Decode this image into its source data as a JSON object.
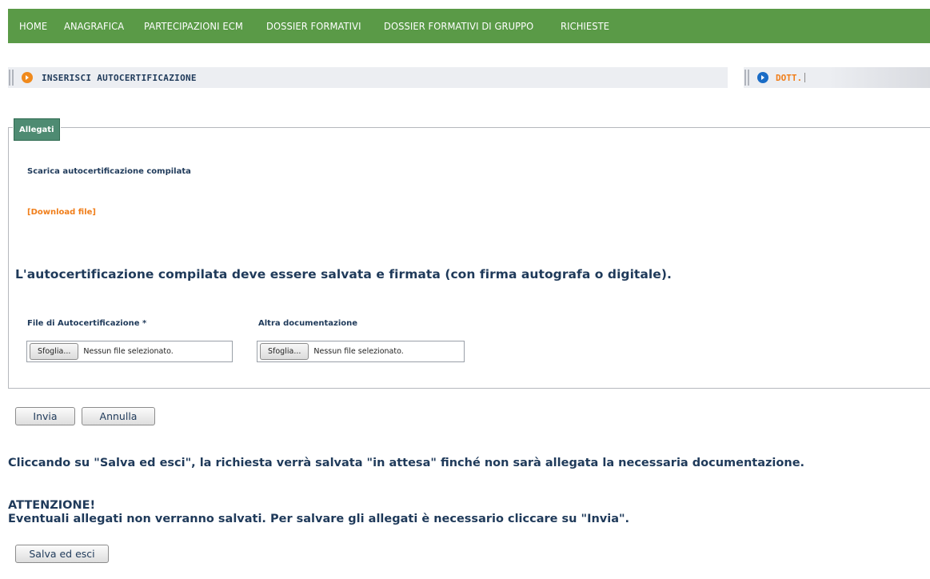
{
  "nav": {
    "items": [
      "HOME",
      "ANAGRAFICA",
      "PARTECIPAZIONI ECM",
      "DOSSIER FORMATIVI",
      "DOSSIER FORMATIVI DI GRUPPO",
      "RICHIESTE"
    ]
  },
  "header": {
    "left_label": "INSERISCI AUTOCERTIFICAZIONE",
    "right_label": "DOTT."
  },
  "allegati": {
    "legend": "Allegati",
    "download_title": "Scarica autocertificazione compilata",
    "download_link": "[Download file]",
    "notice": "L'autocertificazione compilata deve essere salvata e firmata (con firma autografa o digitale).",
    "file1": {
      "label": "File di Autocertificazione *",
      "button": "Sfoglia...",
      "status": "Nessun file selezionato."
    },
    "file2": {
      "label": "Altra documentazione",
      "button": "Sfoglia...",
      "status": "Nessun file selezionato."
    }
  },
  "actions": {
    "invia": "Invia",
    "annulla": "Annulla",
    "salva": "Salva ed esci"
  },
  "info": {
    "line1": "Cliccando su \"Salva ed esci\", la richiesta verrà salvata \"in attesa\" finché non sarà allegata la necessaria documentazione.",
    "attenzione": "ATTENZIONE!",
    "line2": "Eventuali allegati non verranno salvati. Per salvare gli allegati è necessario cliccare su \"Invia\"."
  },
  "colors": {
    "nav_bg": "#5a9a47",
    "accent_orange": "#f07e1a",
    "text_navy": "#1f3a5a",
    "legend_bg": "#4e8b72"
  }
}
